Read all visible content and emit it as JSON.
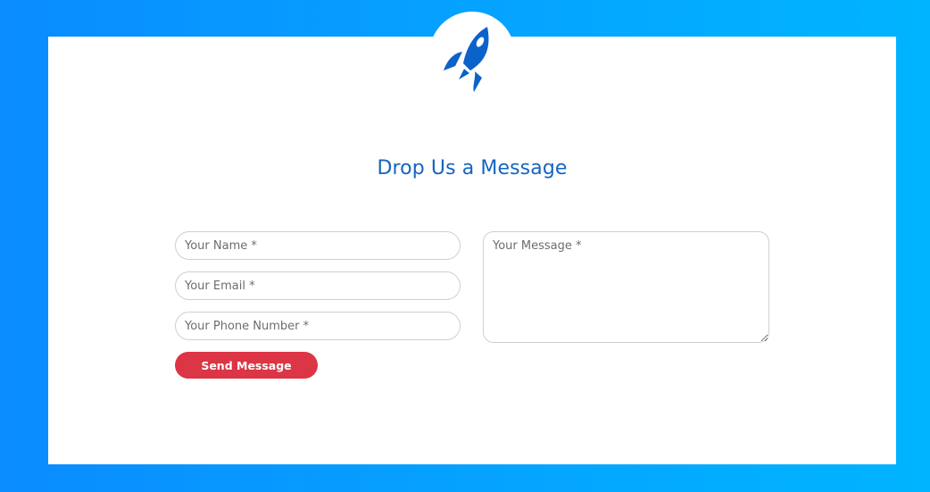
{
  "form": {
    "title": "Drop Us a Message",
    "name_placeholder": "Your Name *",
    "email_placeholder": "Your Email *",
    "phone_placeholder": "Your Phone Number *",
    "message_placeholder": "Your Message *",
    "send_label": "Send Message"
  },
  "logo": {
    "icon": "rocket-icon",
    "color": "#0b63c9"
  },
  "colors": {
    "background_start": "#0a8cff",
    "background_end": "#00b4ff",
    "title": "#1565c0",
    "button": "#dc3545"
  }
}
